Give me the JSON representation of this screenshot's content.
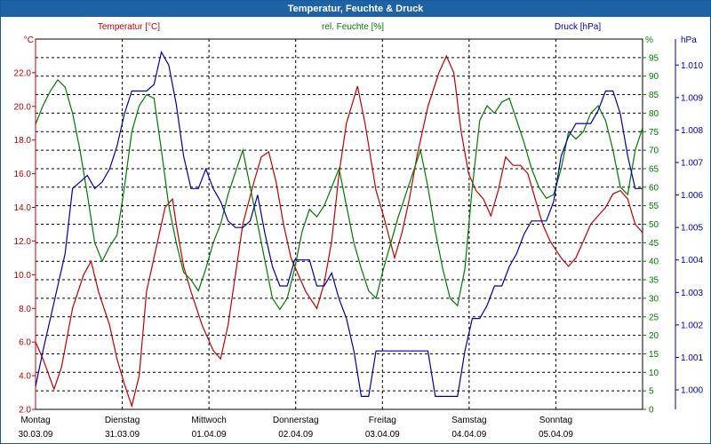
{
  "window": {
    "title": "Temperatur, Feuchte & Druck"
  },
  "colors": {
    "temperature": "#c00000",
    "humidity": "#007a00",
    "pressure": "#0000a8",
    "grid": "#000000"
  },
  "chart_data": {
    "type": "line",
    "title": "Temperatur, Feuchte & Druck",
    "grid": true,
    "x_unit": "days from 30.03.09 00:00",
    "x_range": [
      0,
      7
    ],
    "day_labels": [
      {
        "day": "Montag",
        "date": "30.03.09"
      },
      {
        "day": "Dienstag",
        "date": "31.03.09"
      },
      {
        "day": "Mittwoch",
        "date": "01.04.09"
      },
      {
        "day": "Donnerstag",
        "date": "02.04.09"
      },
      {
        "day": "Freitag",
        "date": "03.04.09"
      },
      {
        "day": "Samstag",
        "date": "04.04.09"
      },
      {
        "day": "Sonntag",
        "date": "05.04.09"
      }
    ],
    "axes": {
      "left": {
        "label": "Temperatur [°C]",
        "unit": "°C",
        "min": 2,
        "max": 24,
        "ticks": [
          "2.0",
          "4.0",
          "6.0",
          "8.0",
          "10.0",
          "12.0",
          "14.0",
          "16.0",
          "18.0",
          "20.0",
          "22.0"
        ]
      },
      "right1": {
        "label": "rel. Feuchte [%]",
        "unit": "%",
        "min": 0,
        "max": 100,
        "ticks": [
          "0",
          "5",
          "10",
          "15",
          "20",
          "25",
          "30",
          "35",
          "40",
          "45",
          "50",
          "55",
          "60",
          "65",
          "70",
          "75",
          "80",
          "85",
          "90",
          "95"
        ]
      },
      "right2": {
        "label": "Druck [hPa]",
        "unit": "hPa",
        "min": 0.9994,
        "max": 1.0108,
        "ticks": [
          "1.000",
          "1.001",
          "1.002",
          "1.003",
          "1.004",
          "1.005",
          "1.006",
          "1.007",
          "1.008",
          "1.009",
          "1.010"
        ]
      }
    },
    "series": [
      {
        "name": "Temperatur [°C]",
        "axis": "left",
        "color": "#c00000",
        "points": [
          [
            0,
            6
          ],
          [
            0.1,
            5
          ],
          [
            0.25,
            3.2
          ],
          [
            0.35,
            4.5
          ],
          [
            0.5,
            8
          ],
          [
            0.65,
            10
          ],
          [
            0.75,
            10.8
          ],
          [
            0.85,
            9
          ],
          [
            1.0,
            7
          ],
          [
            1.1,
            5
          ],
          [
            1.2,
            3.5
          ],
          [
            1.3,
            2.2
          ],
          [
            1.4,
            4
          ],
          [
            1.5,
            9
          ],
          [
            1.65,
            12
          ],
          [
            1.75,
            14
          ],
          [
            1.85,
            14.5
          ],
          [
            1.9,
            13
          ],
          [
            2.0,
            10.5
          ],
          [
            2.1,
            9
          ],
          [
            2.25,
            7
          ],
          [
            2.4,
            5.5
          ],
          [
            2.5,
            5
          ],
          [
            2.6,
            7
          ],
          [
            2.7,
            10
          ],
          [
            2.8,
            13
          ],
          [
            2.95,
            15.5
          ],
          [
            3.05,
            17
          ],
          [
            3.15,
            17.3
          ],
          [
            3.25,
            15.5
          ],
          [
            3.35,
            13
          ],
          [
            3.45,
            11
          ],
          [
            3.55,
            10
          ],
          [
            3.65,
            9
          ],
          [
            3.8,
            8
          ],
          [
            3.9,
            9.5
          ],
          [
            4.0,
            12
          ],
          [
            4.1,
            16
          ],
          [
            4.2,
            19
          ],
          [
            4.35,
            21.2
          ],
          [
            4.45,
            19
          ],
          [
            4.6,
            15
          ],
          [
            4.7,
            13.5
          ],
          [
            4.85,
            11
          ],
          [
            4.95,
            12.5
          ],
          [
            5.05,
            14.5
          ],
          [
            5.15,
            17
          ],
          [
            5.3,
            20
          ],
          [
            5.45,
            22
          ],
          [
            5.55,
            23
          ],
          [
            5.65,
            22
          ],
          [
            5.75,
            18.5
          ],
          [
            5.85,
            16
          ],
          [
            5.95,
            15
          ],
          [
            6.05,
            14.5
          ],
          [
            6.15,
            13.5
          ],
          [
            6.25,
            15
          ],
          [
            6.35,
            17
          ],
          [
            6.45,
            16.5
          ],
          [
            6.55,
            16.5
          ],
          [
            6.65,
            16
          ],
          [
            6.75,
            14.5
          ],
          [
            6.85,
            13
          ],
          [
            6.95,
            12
          ],
          [
            7.1,
            11
          ],
          [
            7.2,
            10.5
          ],
          [
            7.3,
            11
          ],
          [
            7.4,
            12
          ],
          [
            7.5,
            13
          ],
          [
            7.6,
            13.5
          ],
          [
            7.7,
            14
          ],
          [
            7.8,
            14.8
          ],
          [
            7.9,
            15
          ],
          [
            8.0,
            14.5
          ],
          [
            8.1,
            13
          ],
          [
            8.2,
            12.5
          ]
        ]
      },
      {
        "name": "rel. Feuchte [%]",
        "axis": "right1",
        "color": "#007a00",
        "points": [
          [
            0,
            77
          ],
          [
            0.1,
            82
          ],
          [
            0.2,
            86
          ],
          [
            0.3,
            89
          ],
          [
            0.4,
            87
          ],
          [
            0.5,
            80
          ],
          [
            0.6,
            70
          ],
          [
            0.7,
            58
          ],
          [
            0.8,
            45
          ],
          [
            0.9,
            40
          ],
          [
            1.0,
            44
          ],
          [
            1.1,
            47
          ],
          [
            1.2,
            60
          ],
          [
            1.3,
            75
          ],
          [
            1.4,
            82
          ],
          [
            1.5,
            85
          ],
          [
            1.6,
            84
          ],
          [
            1.7,
            70
          ],
          [
            1.8,
            55
          ],
          [
            1.9,
            45
          ],
          [
            2.0,
            37
          ],
          [
            2.1,
            35
          ],
          [
            2.2,
            32
          ],
          [
            2.3,
            38
          ],
          [
            2.4,
            45
          ],
          [
            2.5,
            50
          ],
          [
            2.6,
            58
          ],
          [
            2.7,
            64
          ],
          [
            2.8,
            70
          ],
          [
            2.9,
            60
          ],
          [
            3.0,
            50
          ],
          [
            3.1,
            40
          ],
          [
            3.2,
            30
          ],
          [
            3.3,
            27
          ],
          [
            3.4,
            30
          ],
          [
            3.5,
            38
          ],
          [
            3.6,
            48
          ],
          [
            3.7,
            54
          ],
          [
            3.8,
            52
          ],
          [
            3.9,
            55
          ],
          [
            4.0,
            60
          ],
          [
            4.1,
            65
          ],
          [
            4.2,
            55
          ],
          [
            4.3,
            45
          ],
          [
            4.4,
            38
          ],
          [
            4.5,
            32
          ],
          [
            4.6,
            30
          ],
          [
            4.7,
            38
          ],
          [
            4.8,
            45
          ],
          [
            4.9,
            52
          ],
          [
            5.0,
            58
          ],
          [
            5.1,
            64
          ],
          [
            5.2,
            70
          ],
          [
            5.3,
            60
          ],
          [
            5.4,
            48
          ],
          [
            5.5,
            38
          ],
          [
            5.6,
            30
          ],
          [
            5.7,
            28
          ],
          [
            5.8,
            38
          ],
          [
            5.9,
            60
          ],
          [
            6.0,
            78
          ],
          [
            6.1,
            82
          ],
          [
            6.2,
            80
          ],
          [
            6.3,
            83
          ],
          [
            6.4,
            84
          ],
          [
            6.5,
            78
          ],
          [
            6.6,
            72
          ],
          [
            6.7,
            65
          ],
          [
            6.8,
            60
          ],
          [
            6.9,
            57
          ],
          [
            7.0,
            58
          ],
          [
            7.1,
            65
          ],
          [
            7.2,
            75
          ],
          [
            7.3,
            73
          ],
          [
            7.4,
            75
          ],
          [
            7.5,
            80
          ],
          [
            7.6,
            82
          ],
          [
            7.7,
            78
          ],
          [
            7.8,
            70
          ],
          [
            7.9,
            60
          ],
          [
            8.0,
            58
          ],
          [
            8.1,
            70
          ],
          [
            8.2,
            76
          ]
        ]
      },
      {
        "name": "Druck [hPa]",
        "axis": "right2",
        "color": "#0000a8",
        "points": [
          [
            0,
            1.0001
          ],
          [
            0.1,
            1.0012
          ],
          [
            0.2,
            1.0022
          ],
          [
            0.3,
            1.0032
          ],
          [
            0.4,
            1.0042
          ],
          [
            0.5,
            1.0062
          ],
          [
            0.6,
            1.0064
          ],
          [
            0.7,
            1.0066
          ],
          [
            0.8,
            1.0062
          ],
          [
            0.9,
            1.0064
          ],
          [
            1.0,
            1.0068
          ],
          [
            1.1,
            1.0075
          ],
          [
            1.2,
            1.0085
          ],
          [
            1.3,
            1.0092
          ],
          [
            1.4,
            1.0092
          ],
          [
            1.5,
            1.0092
          ],
          [
            1.6,
            1.0094
          ],
          [
            1.7,
            1.0104
          ],
          [
            1.8,
            1.01
          ],
          [
            1.9,
            1.0088
          ],
          [
            2.0,
            1.0072
          ],
          [
            2.1,
            1.0062
          ],
          [
            2.2,
            1.0062
          ],
          [
            2.3,
            1.0068
          ],
          [
            2.4,
            1.0062
          ],
          [
            2.5,
            1.0058
          ],
          [
            2.6,
            1.0052
          ],
          [
            2.7,
            1.005
          ],
          [
            2.8,
            1.005
          ],
          [
            2.9,
            1.0052
          ],
          [
            3.0,
            1.006
          ],
          [
            3.1,
            1.0048
          ],
          [
            3.2,
            1.0038
          ],
          [
            3.3,
            1.0032
          ],
          [
            3.4,
            1.0032
          ],
          [
            3.5,
            1.004
          ],
          [
            3.6,
            1.004
          ],
          [
            3.7,
            1.004
          ],
          [
            3.8,
            1.0032
          ],
          [
            3.9,
            1.0032
          ],
          [
            4.0,
            1.0036
          ],
          [
            4.1,
            1.0028
          ],
          [
            4.2,
            1.0022
          ],
          [
            4.3,
            1.0012
          ],
          [
            4.4,
            0.9998
          ],
          [
            4.5,
            0.9998
          ],
          [
            4.6,
            1.0012
          ],
          [
            4.7,
            1.0012
          ],
          [
            4.8,
            1.0012
          ],
          [
            4.9,
            1.0012
          ],
          [
            5.0,
            1.0012
          ],
          [
            5.1,
            1.0012
          ],
          [
            5.2,
            1.0012
          ],
          [
            5.3,
            1.0012
          ],
          [
            5.4,
            0.9998
          ],
          [
            5.5,
            0.9998
          ],
          [
            5.6,
            0.9998
          ],
          [
            5.7,
            0.9998
          ],
          [
            5.8,
            1.0012
          ],
          [
            5.9,
            1.0022
          ],
          [
            6.0,
            1.0022
          ],
          [
            6.1,
            1.0026
          ],
          [
            6.2,
            1.0032
          ],
          [
            6.3,
            1.0032
          ],
          [
            6.4,
            1.0038
          ],
          [
            6.5,
            1.0042
          ],
          [
            6.6,
            1.0048
          ],
          [
            6.7,
            1.0052
          ],
          [
            6.8,
            1.0052
          ],
          [
            6.9,
            1.0052
          ],
          [
            7.0,
            1.0058
          ],
          [
            7.1,
            1.0072
          ],
          [
            7.2,
            1.0078
          ],
          [
            7.3,
            1.0082
          ],
          [
            7.4,
            1.0082
          ],
          [
            7.5,
            1.0082
          ],
          [
            7.6,
            1.0086
          ],
          [
            7.7,
            1.0092
          ],
          [
            7.8,
            1.0092
          ],
          [
            7.9,
            1.0085
          ],
          [
            8.0,
            1.0072
          ],
          [
            8.1,
            1.0062
          ],
          [
            8.2,
            1.0062
          ]
        ]
      }
    ]
  }
}
